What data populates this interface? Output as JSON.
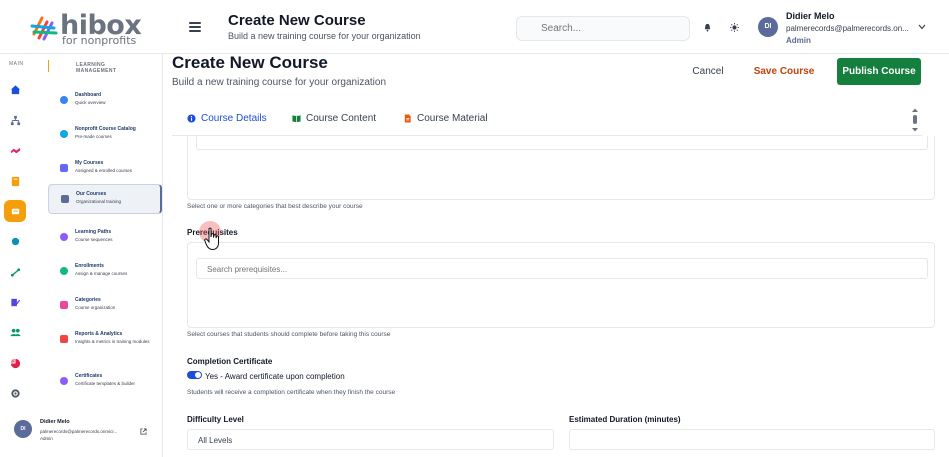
{
  "app": {
    "logo_word": "hibox",
    "logo_sub": "for nonprofits"
  },
  "header": {
    "title": "Create New Course",
    "subtitle": "Build a new training course for your organization",
    "search_placeholder": "Search...",
    "user": {
      "initials": "DI",
      "name": "Didier Melo",
      "email": "palmerecords@palmerecords.on...",
      "role": "Admin"
    }
  },
  "rail": {
    "label": "MAIN",
    "icons": [
      "home-icon",
      "hierarchy-icon",
      "handshake-icon",
      "bookmark-icon",
      "graduation-icon",
      "circle-icon",
      "route-icon",
      "edit-icon",
      "users-icon",
      "pie-chart-icon",
      "settings-icon"
    ],
    "active_color": "#f59e0b"
  },
  "nav": {
    "section_label": "LEARNING MANAGEMENT",
    "items": [
      {
        "label": "Dashboard",
        "desc": "Quick overview",
        "color": "#3b82f6"
      },
      {
        "label": "Nonprofit Course Catalog",
        "desc": "Pre-made courses",
        "color": "#0ea5e9"
      },
      {
        "label": "My Courses",
        "desc": "Assigned & enrolled courses",
        "color": "#6366f1"
      },
      {
        "label": "Our Courses",
        "desc": "Organizational training",
        "color": "#5b6b9a"
      },
      {
        "label": "Learning Paths",
        "desc": "Course sequences",
        "color": "#8b5cf6"
      },
      {
        "label": "Enrollments",
        "desc": "Assign & manage courses",
        "color": "#10b981"
      },
      {
        "label": "Categories",
        "desc": "Course organization",
        "color": "#ec4899"
      },
      {
        "label": "Reports & Analytics",
        "desc": "Insights & metrics in training modules",
        "color": "#ef4444"
      },
      {
        "label": "Certificates",
        "desc": "Certificate templates & builder",
        "color": "#8b5cf6"
      }
    ],
    "user": {
      "initials": "DI",
      "name": "Didier Melo",
      "email": "palmerecords@palmerecords.onmicr...",
      "role": "Admin"
    }
  },
  "page": {
    "title": "Create New Course",
    "subtitle": "Build a new training course for your organization",
    "cancel_label": "Cancel",
    "save_label": "Save Course",
    "publish_label": "Publish Course"
  },
  "tabs": [
    {
      "label": "Course Details",
      "icon": "info-icon",
      "active": true
    },
    {
      "label": "Course Content",
      "icon": "book-icon",
      "active": false
    },
    {
      "label": "Course Material",
      "icon": "file-icon",
      "active": false
    }
  ],
  "form": {
    "categories_help": "Select one or more categories that best describe your course",
    "prerequisites_label": "Prerequisites",
    "prerequisites_placeholder": "Search prerequisites...",
    "prerequisites_help": "Select courses that students should complete before taking this course",
    "certificate_label": "Completion Certificate",
    "certificate_toggle_label": "Yes - Award certificate upon completion",
    "certificate_toggle_on": true,
    "certificate_help": "Students will receive a completion certificate when they finish the course",
    "difficulty_label": "Difficulty Level",
    "difficulty_value": "All Levels",
    "duration_label": "Estimated Duration (minutes)",
    "duration_value": ""
  }
}
